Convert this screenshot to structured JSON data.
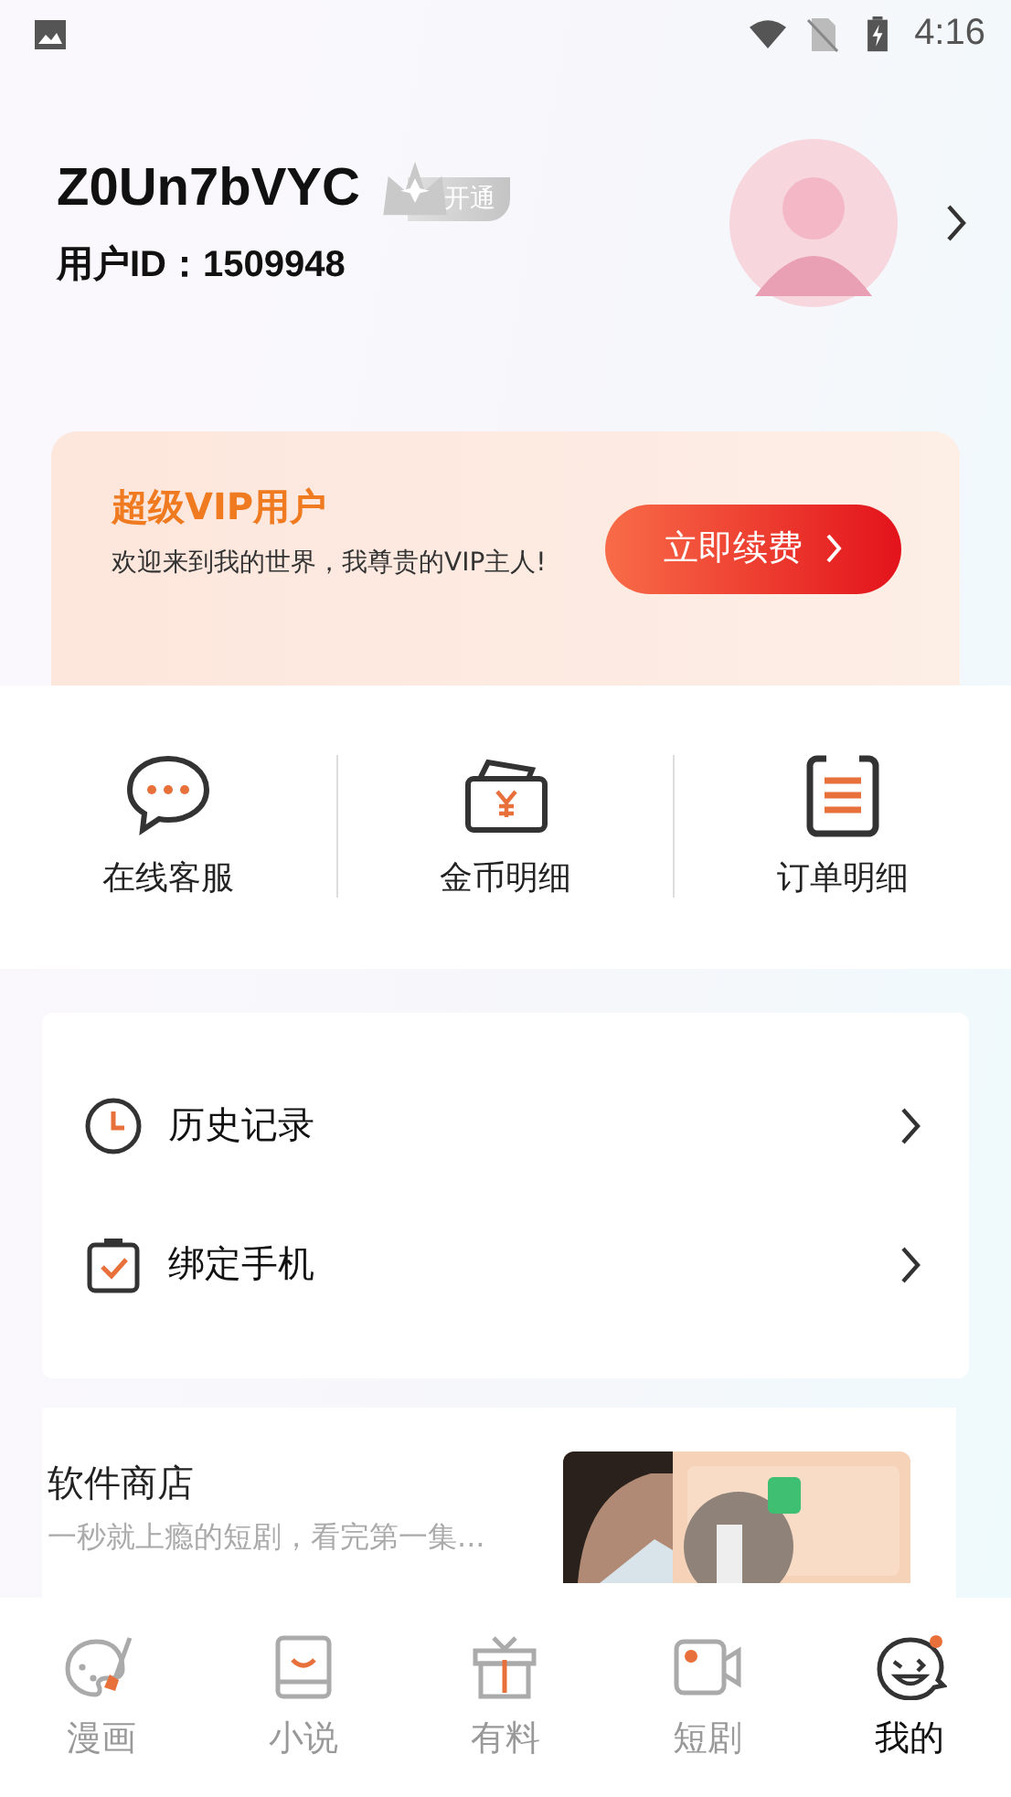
{
  "status_bar": {
    "time": "4:16"
  },
  "profile": {
    "username": "Z0Un7bVYC",
    "vip_badge": "开通",
    "user_id": "用户ID：1509948"
  },
  "vip_card": {
    "title": "超级VIP用户",
    "message": "欢迎来到我的世界，我尊贵的VIP主人!",
    "button": "立即续费"
  },
  "quick_actions": [
    {
      "kind": "chat",
      "label": "在线客服"
    },
    {
      "kind": "wallet",
      "label": "金币明细"
    },
    {
      "kind": "clipboard",
      "label": "订单明细"
    }
  ],
  "menu": [
    {
      "kind": "clock",
      "label": "历史记录"
    },
    {
      "kind": "phone",
      "label": "绑定手机"
    }
  ],
  "store": {
    "title": "软件商店",
    "subtitle": "一秒就上瘾的短剧，看完第一集..."
  },
  "tab_bar": [
    {
      "kind": "palette",
      "label": "漫画",
      "selected": false
    },
    {
      "kind": "book",
      "label": "小说",
      "selected": false
    },
    {
      "kind": "gift",
      "label": "有料",
      "selected": false
    },
    {
      "kind": "video",
      "label": "短剧",
      "selected": false
    },
    {
      "kind": "face",
      "label": "我的",
      "selected": true
    }
  ]
}
